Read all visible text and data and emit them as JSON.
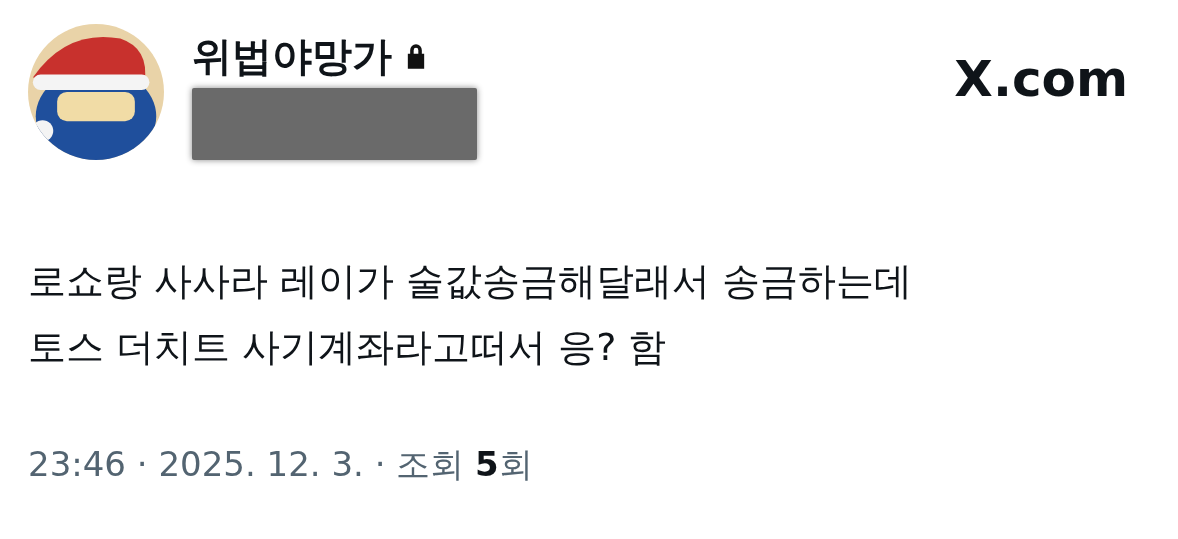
{
  "author": {
    "name": "위법야망가",
    "protected": true,
    "handle_redacted": true
  },
  "brand": "X.com",
  "tweet": {
    "text": "로쇼랑 사사라 레이가 술값송금해달래서 송금하는데\n토스 더치트 사기계좌라고떠서 응? 함"
  },
  "meta": "23:46 · 2025. 12. 3. · 조회 **5**회"
}
